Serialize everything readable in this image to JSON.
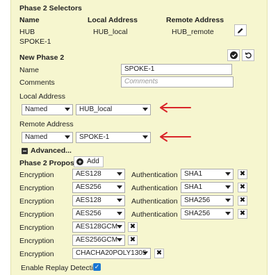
{
  "phase2_selectors": {
    "title": "Phase 2 Selectors",
    "headers": [
      "Name",
      "Local Address",
      "Remote Address"
    ],
    "rows": [
      {
        "name": "HUB",
        "local": "HUB_local",
        "remote": "HUB_remote"
      },
      {
        "name": "SPOKE-1",
        "local": "",
        "remote": ""
      }
    ],
    "edit_icon": "pencil-icon"
  },
  "new_phase2": {
    "title": "New Phase 2",
    "confirm_icon": "check-circle-icon",
    "undo_icon": "undo-icon",
    "name_label": "Name",
    "name_value": "SPOKE-1",
    "comments_label": "Comments",
    "comments_placeholder": "Comments",
    "local_address_label": "Local Address",
    "local_type": "Named Address",
    "local_value": "HUB_local",
    "remote_address_label": "Remote Address",
    "remote_type": "Named Address",
    "remote_value": "SPOKE-1",
    "advanced_label": "Advanced...",
    "proposal_label": "Phase 2 Proposal",
    "add_label": "Add",
    "encryption_label": "Encryption",
    "authentication_label": "Authentication",
    "proposals": [
      {
        "enc": "AES128",
        "auth": "SHA1"
      },
      {
        "enc": "AES256",
        "auth": "SHA1"
      },
      {
        "enc": "AES128",
        "auth": "SHA256"
      },
      {
        "enc": "AES256",
        "auth": "SHA256"
      },
      {
        "enc": "AES128GCM",
        "auth": ""
      },
      {
        "enc": "AES256GCM",
        "auth": ""
      },
      {
        "enc": "CHACHA20POLY1305",
        "auth": ""
      }
    ],
    "replay_label": "Enable Replay Detection",
    "replay_checked": true
  },
  "colors": {
    "panel_bg": "#f6f6cf",
    "arrow": "#d9252a",
    "checkbox": "#1976d2"
  }
}
